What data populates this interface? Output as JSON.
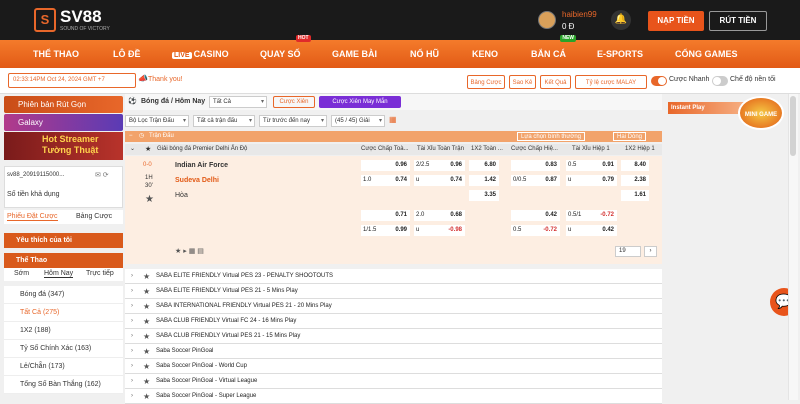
{
  "header": {
    "logo_mark": "S",
    "logo_name": "SV88",
    "logo_tagline": "SOUND OF VICTORY",
    "username": "haibien99",
    "balance": "0 Đ",
    "deposit": "NẠP TIỀN",
    "withdraw": "RÚT TIỀN"
  },
  "nav": {
    "items": [
      "THỂ THAO",
      "LÔ ĐỀ",
      "CASINO",
      "QUAY SỐ",
      "GAME BÀI",
      "NỔ HŨ",
      "KENO",
      "BẮN CÁ",
      "E-SPORTS",
      "CỔNG GAMES"
    ],
    "live": "LIVE",
    "hot": "HOT",
    "new": "NEW"
  },
  "topbar": {
    "time": "02:33:14PM Oct 24, 2024 GMT +7",
    "thanks": "Thank you!",
    "buttons": [
      "Bảng Cược",
      "Sao Kê",
      "Kết Quả",
      "Tỷ lệ cược MALAY"
    ],
    "toggles": [
      "Cược Nhanh",
      "Chế độ nền tối"
    ]
  },
  "sidebar": {
    "promo1": "Phiên bản Rút Gọn",
    "promo2": "Galaxy",
    "banner_line1": "Hot Streamer",
    "banner_line2": "Tường Thuật",
    "account": "sv88_20919115000...",
    "balance_label": "Số tiền khả dụng",
    "tabs": [
      "Phiếu Đặt Cược",
      "Bảng Cược"
    ],
    "fav": "Yêu thích của tôi",
    "sport": "Thể Thao",
    "subtabs": [
      "Sớm",
      "Hôm Nay",
      "Trực tiếp"
    ],
    "items": [
      {
        "label": "Bóng đá",
        "count": "(347)"
      },
      {
        "label": "Tất Cả",
        "count": "(275)"
      },
      {
        "label": "1X2",
        "count": "(188)"
      },
      {
        "label": "Tỷ Số Chính Xác",
        "count": "(163)"
      },
      {
        "label": "Lẻ/Chẵn",
        "count": "(173)"
      },
      {
        "label": "Tổng Số Bàn Thắng",
        "count": "(162)"
      }
    ]
  },
  "main": {
    "breadcrumb": "Bóng đá / Hôm Nay",
    "filter_all": "Tất Cả",
    "parlay": "Cược Xiên",
    "lucky": "Cược Xiên May Mắn",
    "filters": [
      "Bộ Lọc Trận Đấu",
      "Tất cả trận đấu",
      "Từ trước đến nay"
    ],
    "count": "(45 / 45) Giải",
    "tran_dau": "Trận Đấu",
    "sort": "Lựa chọn bình thường",
    "lines": "Hai Dòng",
    "league": "Giải bóng đá Premier Delhi Ấn Độ",
    "cols": [
      "Cược Chấp Toà...",
      "Tài Xỉu Toàn Trận",
      "1X2 Toàn ...",
      "Cược Chấp Hiệ...",
      "Tài Xỉu Hiệp 1",
      "1X2 Hiệp 1"
    ],
    "score": "0-0",
    "period": "1H",
    "minute": "30'",
    "home": "Indian Air Force",
    "away": "Sudeva Delhi",
    "draw": "Hòa",
    "row1": [
      "",
      "0.96",
      "2/2.5",
      "0.96",
      "6.80",
      "",
      "0.83",
      "0.5",
      "0.91",
      "8.40"
    ],
    "row2": [
      "1.0",
      "0.74",
      "u",
      "0.74",
      "1.42",
      "0/0.5",
      "0.87",
      "u",
      "0.79",
      "2.38"
    ],
    "row3": [
      "3.35",
      "1.61"
    ],
    "row4": [
      "",
      "0.71",
      "2.0",
      "0.68",
      "",
      "0.42",
      "0.5/1",
      "-0.72"
    ],
    "row5": [
      "1/1.5",
      "0.99",
      "u",
      "-0.98",
      "0.5",
      "-0.72",
      "u",
      "0.42"
    ],
    "page": "19",
    "leagues": [
      "SABA ELITE FRIENDLY Virtual PES 23 - PENALTY SHOOTOUTS",
      "SABA ELITE FRIENDLY Virtual PES 21 - 5 Mins Play",
      "SABA INTERNATIONAL FRIENDLY Virtual PES 21 - 20 Mins Play",
      "SABA CLUB FRIENDLY Virtual FC 24 - 16 Mins Play",
      "SABA CLUB FRIENDLY Virtual PES 21 - 15 Mins Play",
      "Saba Soccer PinGoal",
      "Saba Soccer PinGoal - World Cup",
      "Saba Soccer PinGoal - Virtual League",
      "Saba Soccer PinGoal - Super League"
    ]
  },
  "right": {
    "instant": "Instant Play",
    "game": "MINI GAME"
  }
}
